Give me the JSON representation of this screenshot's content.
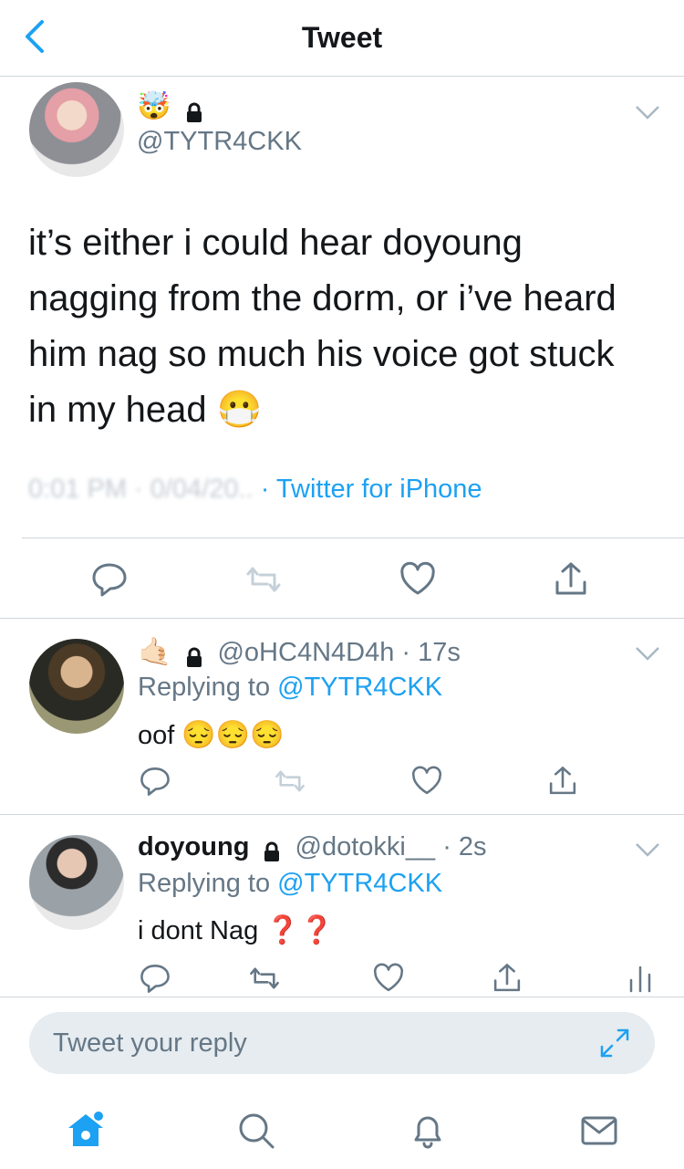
{
  "header": {
    "title": "Tweet",
    "back_icon": "chevron-left-icon"
  },
  "main_tweet": {
    "emoji_name": "🤯",
    "handle": "@TYTR4CKK",
    "text_lines": [
      "it’s either i could hear doyoung",
      "nagging from the dorm, or i’ve heard",
      "him nag so much his voice got stuck",
      "in my head 😷"
    ],
    "timestamp_obscured": "0:01 PM · 0/04/20..",
    "source": "· Twitter for iPhone"
  },
  "replies": [
    {
      "display_name": "🤙🏻",
      "handle": "@oHC4N4D4h",
      "time": "· 17s",
      "replying_prefix": "Replying to",
      "replying_handle": "@TYTR4CKK",
      "text": "oof",
      "emojis": "😔😔😔"
    },
    {
      "display_name": "doyoung",
      "handle": "@dotokki__",
      "time": "· 2s",
      "replying_prefix": "Replying to",
      "replying_handle": "@TYTR4CKK",
      "text": "i dont Nag",
      "question_marks": "❓❓"
    }
  ],
  "composer": {
    "placeholder": "Tweet your reply"
  },
  "colors": {
    "accent": "#1da1f2",
    "secondary_text": "#657786",
    "divider": "#d0d6db"
  },
  "tabs": [
    "home-icon",
    "search-icon",
    "notifications-icon",
    "messages-icon"
  ]
}
